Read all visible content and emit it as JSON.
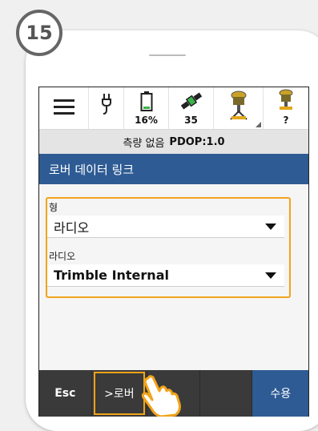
{
  "step": "15",
  "toolbar": {
    "battery_label": "16%",
    "satellites_label": "35",
    "rover_label": "?"
  },
  "status": {
    "survey_state": "측량 없음",
    "pdop": "PDOP:1.0"
  },
  "page_title": "로버 데이터 링크",
  "form": {
    "type_label": "형",
    "type_value": "라디오",
    "radio_label": "라디오",
    "radio_value": "Trimble Internal"
  },
  "bottom_bar": {
    "esc_label": "Esc",
    "rover_label": ">로버",
    "accept_label": "수용"
  },
  "colors": {
    "accent_blue": "#2e5b94",
    "highlight_orange": "#f2a31b",
    "battery_green": "#3cb44a"
  }
}
